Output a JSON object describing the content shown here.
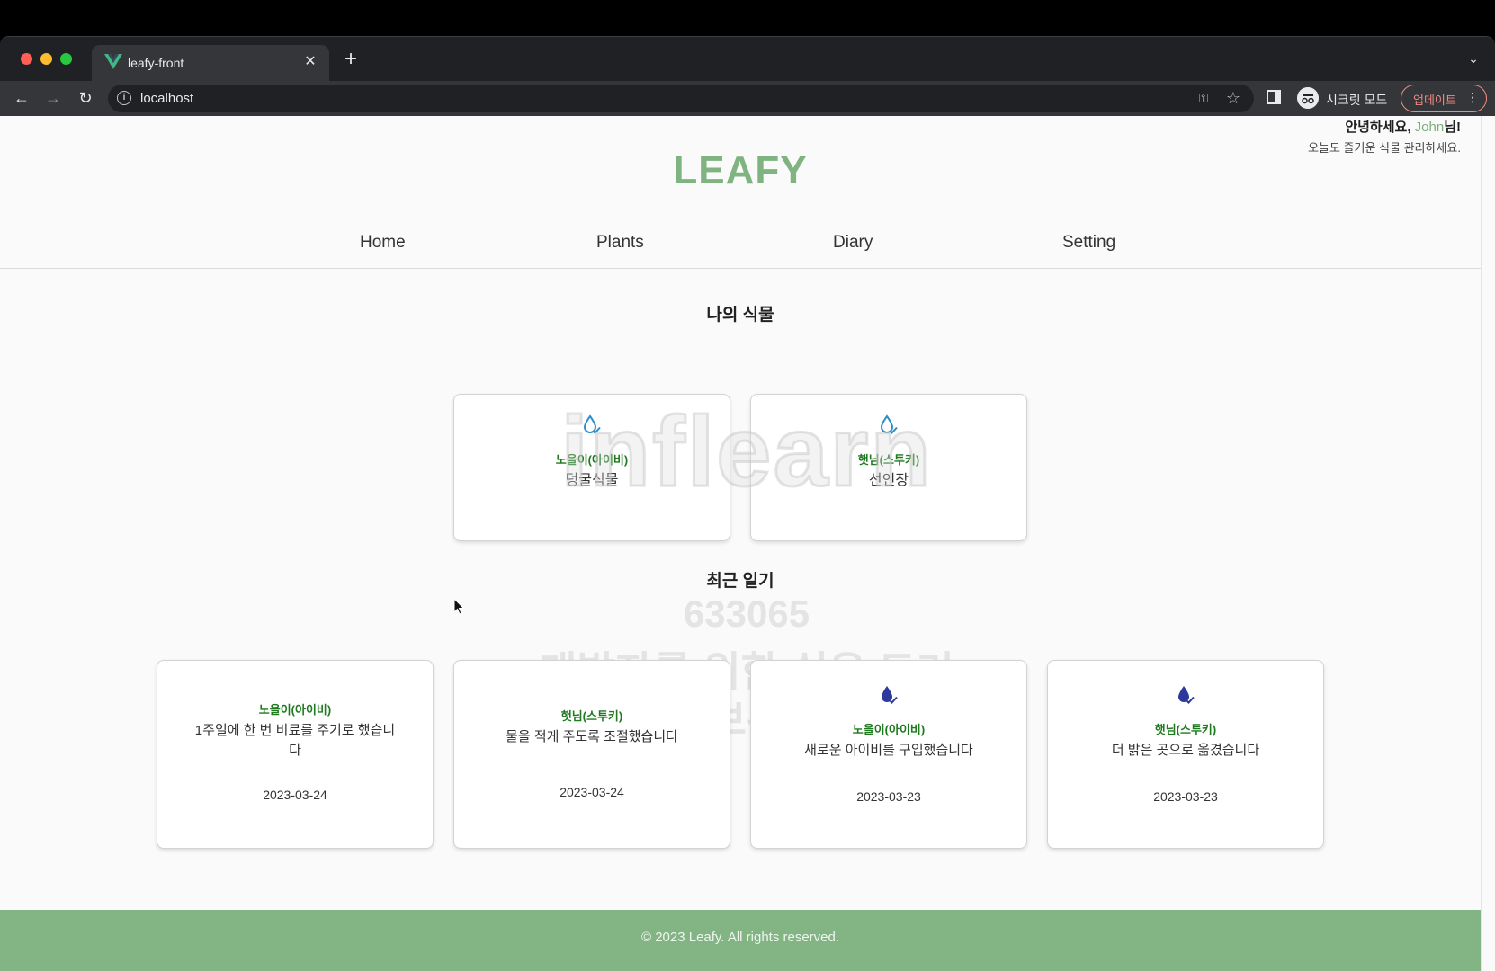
{
  "browser": {
    "tab_title": "leafy-front",
    "url": "localhost",
    "incognito_label": "시크릿 모드",
    "update_label": "업데이트"
  },
  "header": {
    "greeting_prefix": "안녕하세요, ",
    "user_name": "John",
    "greeting_suffix": "님!",
    "subtitle": "오늘도 즐거운 식물 관리하세요.",
    "logo": "LEAFY"
  },
  "nav": {
    "items": [
      {
        "label": "Home"
      },
      {
        "label": "Plants"
      },
      {
        "label": "Diary"
      },
      {
        "label": "Setting"
      }
    ]
  },
  "plants": {
    "title": "나의 식물",
    "items": [
      {
        "name": "노을이(아이비)",
        "type": "덩굴식물",
        "icon": "water-drop-outline-icon"
      },
      {
        "name": "햇님(스투키)",
        "type": "선인장",
        "icon": "water-drop-outline-icon"
      }
    ]
  },
  "diary": {
    "title": "최근 일기",
    "items": [
      {
        "name": "노을이(아이비)",
        "text": "1주일에 한 번 비료를 주기로 했습니다",
        "date": "2023-03-24"
      },
      {
        "name": "햇님(스투키)",
        "text": "물을 적게 주도록 조절했습니다",
        "date": "2023-03-24"
      },
      {
        "name": "노을이(아이비)",
        "text": "새로운 아이비를 구입했습니다",
        "date": "2023-03-23",
        "icon": "water-drop-filled-icon"
      },
      {
        "name": "햇님(스투키)",
        "text": "더 밝은 곳으로 옮겼습니다",
        "date": "2023-03-23",
        "icon": "water-drop-filled-icon"
      }
    ]
  },
  "watermark": {
    "logo": "inflearn",
    "code": "633065",
    "line1": "개발자를 위한 쉬운 도커",
    "line2": "데브위키"
  },
  "footer": {
    "text": "© 2023 Leafy. All rights reserved."
  },
  "colors": {
    "brand_green": "#7fb380",
    "footer_green": "#83b484",
    "plant_name_green": "#1f7a1f",
    "drop_outline_blue": "#2b8fc9",
    "drop_filled_navy": "#2d3a9c"
  }
}
